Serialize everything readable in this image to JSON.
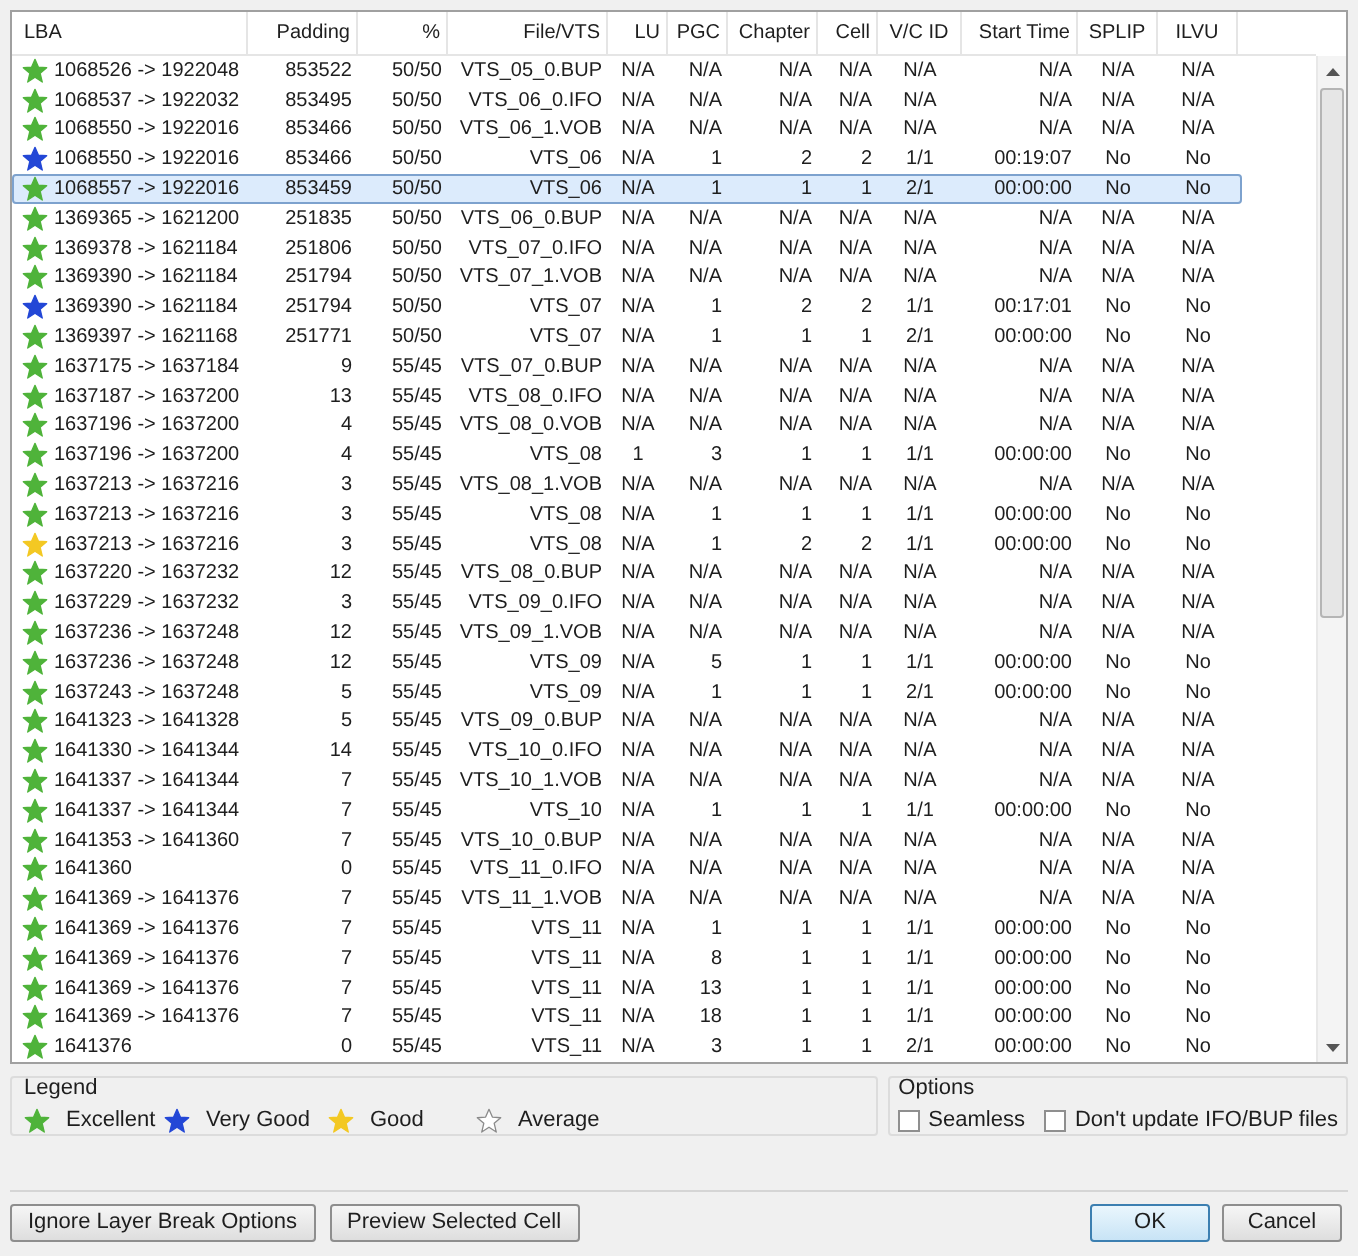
{
  "table": {
    "columns": [
      "LBA",
      "Padding",
      "%",
      "File/VTS",
      "LU",
      "PGC",
      "Chapter",
      "Cell",
      "V/C ID",
      "Start Time",
      "SPLIP",
      "ILVU"
    ],
    "rows": [
      {
        "color": "#4fb33a",
        "selected": false,
        "cells": [
          "1068526 -> 1922048",
          "853522",
          "50/50",
          "VTS_05_0.BUP",
          "N/A",
          "N/A",
          "N/A",
          "N/A",
          "N/A",
          "N/A",
          "N/A",
          "N/A"
        ]
      },
      {
        "color": "#4fb33a",
        "selected": false,
        "cells": [
          "1068537 -> 1922032",
          "853495",
          "50/50",
          "VTS_06_0.IFO",
          "N/A",
          "N/A",
          "N/A",
          "N/A",
          "N/A",
          "N/A",
          "N/A",
          "N/A"
        ]
      },
      {
        "color": "#4fb33a",
        "selected": false,
        "cells": [
          "1068550 -> 1922016",
          "853466",
          "50/50",
          "VTS_06_1.VOB",
          "N/A",
          "N/A",
          "N/A",
          "N/A",
          "N/A",
          "N/A",
          "N/A",
          "N/A"
        ]
      },
      {
        "color": "#2347d6",
        "selected": false,
        "cells": [
          "1068550 -> 1922016",
          "853466",
          "50/50",
          "VTS_06",
          "N/A",
          "1",
          "2",
          "2",
          "1/1",
          "00:19:07",
          "No",
          "No"
        ]
      },
      {
        "color": "#4fb33a",
        "selected": true,
        "cells": [
          "1068557 -> 1922016",
          "853459",
          "50/50",
          "VTS_06",
          "N/A",
          "1",
          "1",
          "1",
          "2/1",
          "00:00:00",
          "No",
          "No"
        ]
      },
      {
        "color": "#4fb33a",
        "selected": false,
        "cells": [
          "1369365 -> 1621200",
          "251835",
          "50/50",
          "VTS_06_0.BUP",
          "N/A",
          "N/A",
          "N/A",
          "N/A",
          "N/A",
          "N/A",
          "N/A",
          "N/A"
        ]
      },
      {
        "color": "#4fb33a",
        "selected": false,
        "cells": [
          "1369378 -> 1621184",
          "251806",
          "50/50",
          "VTS_07_0.IFO",
          "N/A",
          "N/A",
          "N/A",
          "N/A",
          "N/A",
          "N/A",
          "N/A",
          "N/A"
        ]
      },
      {
        "color": "#4fb33a",
        "selected": false,
        "cells": [
          "1369390 -> 1621184",
          "251794",
          "50/50",
          "VTS_07_1.VOB",
          "N/A",
          "N/A",
          "N/A",
          "N/A",
          "N/A",
          "N/A",
          "N/A",
          "N/A"
        ]
      },
      {
        "color": "#2347d6",
        "selected": false,
        "cells": [
          "1369390 -> 1621184",
          "251794",
          "50/50",
          "VTS_07",
          "N/A",
          "1",
          "2",
          "2",
          "1/1",
          "00:17:01",
          "No",
          "No"
        ]
      },
      {
        "color": "#4fb33a",
        "selected": false,
        "cells": [
          "1369397 -> 1621168",
          "251771",
          "50/50",
          "VTS_07",
          "N/A",
          "1",
          "1",
          "1",
          "2/1",
          "00:00:00",
          "No",
          "No"
        ]
      },
      {
        "color": "#4fb33a",
        "selected": false,
        "cells": [
          "1637175 -> 1637184",
          "9",
          "55/45",
          "VTS_07_0.BUP",
          "N/A",
          "N/A",
          "N/A",
          "N/A",
          "N/A",
          "N/A",
          "N/A",
          "N/A"
        ]
      },
      {
        "color": "#4fb33a",
        "selected": false,
        "cells": [
          "1637187 -> 1637200",
          "13",
          "55/45",
          "VTS_08_0.IFO",
          "N/A",
          "N/A",
          "N/A",
          "N/A",
          "N/A",
          "N/A",
          "N/A",
          "N/A"
        ]
      },
      {
        "color": "#4fb33a",
        "selected": false,
        "cells": [
          "1637196 -> 1637200",
          "4",
          "55/45",
          "VTS_08_0.VOB",
          "N/A",
          "N/A",
          "N/A",
          "N/A",
          "N/A",
          "N/A",
          "N/A",
          "N/A"
        ]
      },
      {
        "color": "#4fb33a",
        "selected": false,
        "cells": [
          "1637196 -> 1637200",
          "4",
          "55/45",
          "VTS_08",
          "1",
          "3",
          "1",
          "1",
          "1/1",
          "00:00:00",
          "No",
          "No"
        ]
      },
      {
        "color": "#4fb33a",
        "selected": false,
        "cells": [
          "1637213 -> 1637216",
          "3",
          "55/45",
          "VTS_08_1.VOB",
          "N/A",
          "N/A",
          "N/A",
          "N/A",
          "N/A",
          "N/A",
          "N/A",
          "N/A"
        ]
      },
      {
        "color": "#4fb33a",
        "selected": false,
        "cells": [
          "1637213 -> 1637216",
          "3",
          "55/45",
          "VTS_08",
          "N/A",
          "1",
          "1",
          "1",
          "1/1",
          "00:00:00",
          "No",
          "No"
        ]
      },
      {
        "color": "#f3c823",
        "selected": false,
        "cells": [
          "1637213 -> 1637216",
          "3",
          "55/45",
          "VTS_08",
          "N/A",
          "1",
          "2",
          "2",
          "1/1",
          "00:00:00",
          "No",
          "No"
        ]
      },
      {
        "color": "#4fb33a",
        "selected": false,
        "cells": [
          "1637220 -> 1637232",
          "12",
          "55/45",
          "VTS_08_0.BUP",
          "N/A",
          "N/A",
          "N/A",
          "N/A",
          "N/A",
          "N/A",
          "N/A",
          "N/A"
        ]
      },
      {
        "color": "#4fb33a",
        "selected": false,
        "cells": [
          "1637229 -> 1637232",
          "3",
          "55/45",
          "VTS_09_0.IFO",
          "N/A",
          "N/A",
          "N/A",
          "N/A",
          "N/A",
          "N/A",
          "N/A",
          "N/A"
        ]
      },
      {
        "color": "#4fb33a",
        "selected": false,
        "cells": [
          "1637236 -> 1637248",
          "12",
          "55/45",
          "VTS_09_1.VOB",
          "N/A",
          "N/A",
          "N/A",
          "N/A",
          "N/A",
          "N/A",
          "N/A",
          "N/A"
        ]
      },
      {
        "color": "#4fb33a",
        "selected": false,
        "cells": [
          "1637236 -> 1637248",
          "12",
          "55/45",
          "VTS_09",
          "N/A",
          "5",
          "1",
          "1",
          "1/1",
          "00:00:00",
          "No",
          "No"
        ]
      },
      {
        "color": "#4fb33a",
        "selected": false,
        "cells": [
          "1637243 -> 1637248",
          "5",
          "55/45",
          "VTS_09",
          "N/A",
          "1",
          "1",
          "1",
          "2/1",
          "00:00:00",
          "No",
          "No"
        ]
      },
      {
        "color": "#4fb33a",
        "selected": false,
        "cells": [
          "1641323 -> 1641328",
          "5",
          "55/45",
          "VTS_09_0.BUP",
          "N/A",
          "N/A",
          "N/A",
          "N/A",
          "N/A",
          "N/A",
          "N/A",
          "N/A"
        ]
      },
      {
        "color": "#4fb33a",
        "selected": false,
        "cells": [
          "1641330 -> 1641344",
          "14",
          "55/45",
          "VTS_10_0.IFO",
          "N/A",
          "N/A",
          "N/A",
          "N/A",
          "N/A",
          "N/A",
          "N/A",
          "N/A"
        ]
      },
      {
        "color": "#4fb33a",
        "selected": false,
        "cells": [
          "1641337 -> 1641344",
          "7",
          "55/45",
          "VTS_10_1.VOB",
          "N/A",
          "N/A",
          "N/A",
          "N/A",
          "N/A",
          "N/A",
          "N/A",
          "N/A"
        ]
      },
      {
        "color": "#4fb33a",
        "selected": false,
        "cells": [
          "1641337 -> 1641344",
          "7",
          "55/45",
          "VTS_10",
          "N/A",
          "1",
          "1",
          "1",
          "1/1",
          "00:00:00",
          "No",
          "No"
        ]
      },
      {
        "color": "#4fb33a",
        "selected": false,
        "cells": [
          "1641353 -> 1641360",
          "7",
          "55/45",
          "VTS_10_0.BUP",
          "N/A",
          "N/A",
          "N/A",
          "N/A",
          "N/A",
          "N/A",
          "N/A",
          "N/A"
        ]
      },
      {
        "color": "#4fb33a",
        "selected": false,
        "cells": [
          "1641360",
          "0",
          "55/45",
          "VTS_11_0.IFO",
          "N/A",
          "N/A",
          "N/A",
          "N/A",
          "N/A",
          "N/A",
          "N/A",
          "N/A"
        ]
      },
      {
        "color": "#4fb33a",
        "selected": false,
        "cells": [
          "1641369 -> 1641376",
          "7",
          "55/45",
          "VTS_11_1.VOB",
          "N/A",
          "N/A",
          "N/A",
          "N/A",
          "N/A",
          "N/A",
          "N/A",
          "N/A"
        ]
      },
      {
        "color": "#4fb33a",
        "selected": false,
        "cells": [
          "1641369 -> 1641376",
          "7",
          "55/45",
          "VTS_11",
          "N/A",
          "1",
          "1",
          "1",
          "1/1",
          "00:00:00",
          "No",
          "No"
        ]
      },
      {
        "color": "#4fb33a",
        "selected": false,
        "cells": [
          "1641369 -> 1641376",
          "7",
          "55/45",
          "VTS_11",
          "N/A",
          "8",
          "1",
          "1",
          "1/1",
          "00:00:00",
          "No",
          "No"
        ]
      },
      {
        "color": "#4fb33a",
        "selected": false,
        "cells": [
          "1641369 -> 1641376",
          "7",
          "55/45",
          "VTS_11",
          "N/A",
          "13",
          "1",
          "1",
          "1/1",
          "00:00:00",
          "No",
          "No"
        ]
      },
      {
        "color": "#4fb33a",
        "selected": false,
        "cells": [
          "1641369 -> 1641376",
          "7",
          "55/45",
          "VTS_11",
          "N/A",
          "18",
          "1",
          "1",
          "1/1",
          "00:00:00",
          "No",
          "No"
        ]
      },
      {
        "color": "#4fb33a",
        "selected": false,
        "cells": [
          "1641376",
          "0",
          "55/45",
          "VTS_11",
          "N/A",
          "3",
          "1",
          "1",
          "2/1",
          "00:00:00",
          "No",
          "No"
        ]
      }
    ]
  },
  "legend": {
    "title": "Legend",
    "items": [
      {
        "color": "#4fb33a",
        "label": "Excellent"
      },
      {
        "color": "#2347d6",
        "label": "Very Good"
      },
      {
        "color": "#f3c823",
        "label": "Good"
      },
      {
        "color": "#ffffff",
        "label": "Average"
      }
    ]
  },
  "options": {
    "title": "Options",
    "checkboxes": [
      {
        "label": "Seamless",
        "checked": false
      },
      {
        "label": "Don't update IFO/BUP files",
        "checked": false
      }
    ]
  },
  "buttons_left": [
    "Ignore Layer Break Options",
    "Preview Selected Cell"
  ],
  "buttons_right": [
    {
      "label": "OK",
      "default": true
    },
    {
      "label": "Cancel",
      "default": false
    }
  ]
}
